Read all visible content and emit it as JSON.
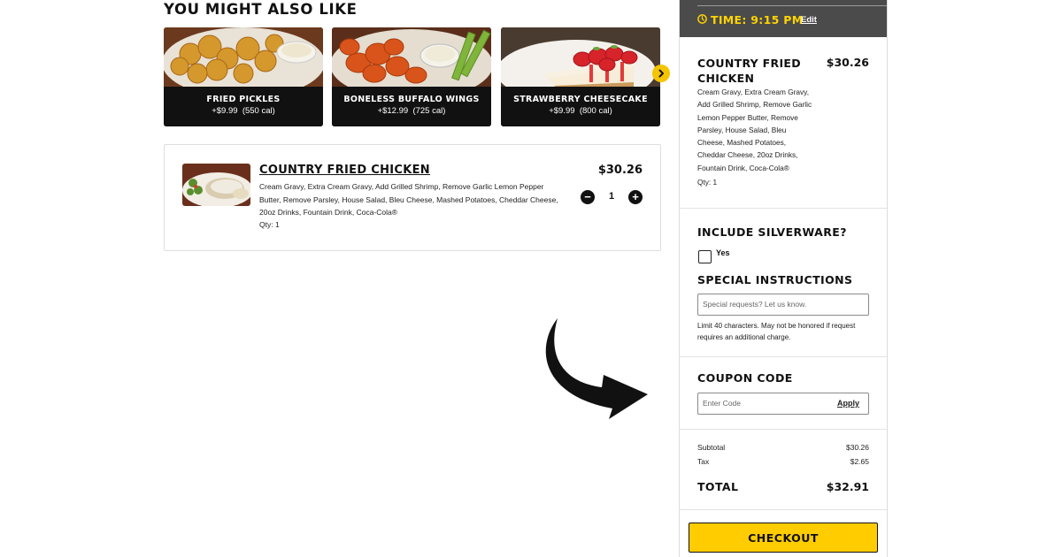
{
  "recommendations": {
    "title": "YOU MIGHT ALSO LIKE",
    "items": [
      {
        "name": "FRIED PICKLES",
        "price": "+$9.99",
        "calories": "(550 cal)"
      },
      {
        "name": "BONELESS BUFFALO WINGS",
        "price": "+$12.99",
        "calories": "(725 cal)"
      },
      {
        "name": "STRAWBERRY CHEESECAKE",
        "price": "+$9.99",
        "calories": "(800 cal)"
      }
    ]
  },
  "cart_item": {
    "name": "COUNTRY FRIED CHICKEN",
    "modifiers": "Cream Gravy, Extra Cream Gravy, Add Grilled Shrimp, Remove Garlic Lemon Pepper Butter, Remove Parsley, House Salad, Bleu Cheese, Mashed Potatoes, Cheddar Cheese, 20oz Drinks, Fountain Drink, Coca-Cola®",
    "qty_label": "Qty: 1",
    "price": "$30.26",
    "quantity": "1",
    "minus": "−",
    "plus": "+"
  },
  "order_panel": {
    "time": "TIME: 9:15 PM",
    "edit_label": "Edit",
    "summary": {
      "name": "COUNTRY FRIED CHICKEN",
      "price": "$30.26",
      "modifiers": "Cream Gravy, Extra Cream Gravy, Add Grilled Shrimp, Remove Garlic Lemon Pepper Butter, Remove Parsley, House Salad, Bleu Cheese, Mashed Potatoes, Cheddar Cheese, 20oz Drinks, Fountain Drink, Coca-Cola®",
      "qty": "Qty: 1"
    },
    "silverware": {
      "title": "INCLUDE SILVERWARE?",
      "option_label": "Yes",
      "checked": false
    },
    "special_instructions": {
      "title": "SPECIAL INSTRUCTIONS",
      "placeholder": "Special requests? Let us know.",
      "note": "Limit 40 characters. May not be honored if request requires an additional charge."
    },
    "coupon": {
      "title": "COUPON CODE",
      "placeholder": "Enter Code",
      "apply_label": "Apply"
    },
    "totals": {
      "subtotal_label": "Subtotal",
      "subtotal": "$30.26",
      "tax_label": "Tax",
      "tax": "$2.65",
      "total_label": "TOTAL",
      "total": "$32.91"
    },
    "checkout_label": "CHECKOUT"
  },
  "colors": {
    "accent_yellow": "#ffcc00",
    "time_text": "#ffd400",
    "time_bar": "#4b4b4b",
    "card_dark": "#111111"
  },
  "icons": [
    "clock-icon",
    "chevron-right-icon",
    "minus-icon",
    "plus-icon",
    "curved-arrow-icon"
  ]
}
